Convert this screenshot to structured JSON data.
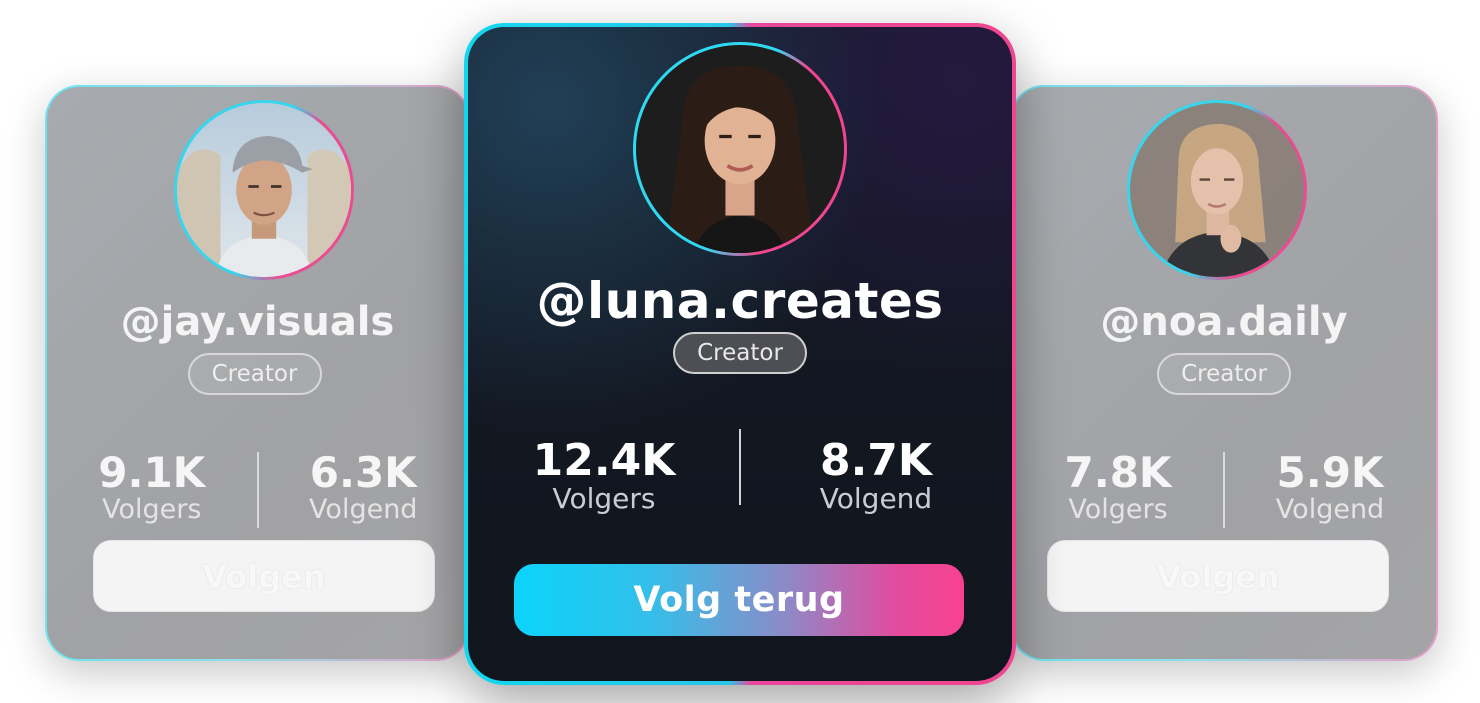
{
  "cards": {
    "left": {
      "handle": "@jay.visuals",
      "badge": "Creator",
      "followers_value": "9.1K",
      "followers_label": "Volgers",
      "following_value": "6.3K",
      "following_label": "Volgend",
      "button_label": "Volgen"
    },
    "center": {
      "handle": "@luna.creates",
      "badge": "Creator",
      "followers_value": "12.4K",
      "followers_label": "Volgers",
      "following_value": "8.7K",
      "following_label": "Volgend",
      "button_label": "Volg terug"
    },
    "right": {
      "handle": "@noa.daily",
      "badge": "Creator",
      "followers_value": "7.8K",
      "followers_label": "Volgers",
      "following_value": "5.9K",
      "following_label": "Volgend",
      "button_label": "Volgen"
    }
  },
  "colors": {
    "accent_cyan": "#13d6ee",
    "accent_pink": "#f0458f",
    "card_dark": "#11151d",
    "card_dimmed": "#a3a4a7"
  }
}
